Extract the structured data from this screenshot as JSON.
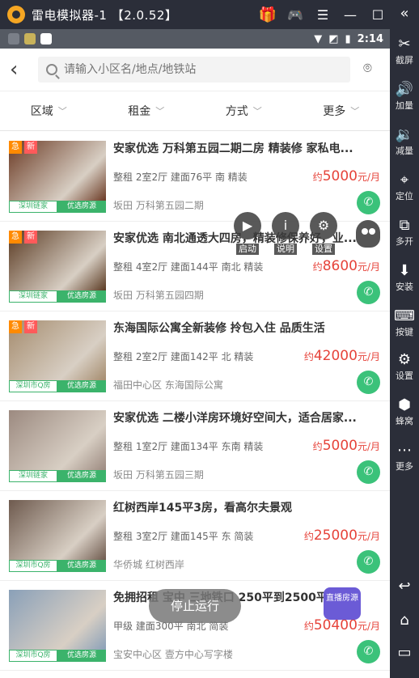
{
  "emulator": {
    "title": "雷电模拟器-1 【2.0.52】",
    "sidebar": [
      {
        "label": "截屏",
        "icon": "scissors-icon",
        "glyph": "✂"
      },
      {
        "label": "加量",
        "icon": "volume-up-icon",
        "glyph": "🔊"
      },
      {
        "label": "减量",
        "icon": "volume-down-icon",
        "glyph": "🔉"
      },
      {
        "label": "定位",
        "icon": "location-pin-icon",
        "glyph": "⌖"
      },
      {
        "label": "多开",
        "icon": "multi-window-icon",
        "glyph": "⧉"
      },
      {
        "label": "安装",
        "icon": "apk-install-icon",
        "glyph": "⬇"
      },
      {
        "label": "按键",
        "icon": "keyboard-icon",
        "glyph": "⌨"
      },
      {
        "label": "设置",
        "icon": "gear-icon",
        "glyph": "⚙"
      },
      {
        "label": "蜂窝",
        "icon": "honeycomb-icon",
        "glyph": "⬢"
      },
      {
        "label": "更多",
        "icon": "more-dots-icon",
        "glyph": "⋯"
      }
    ],
    "nav_buttons": [
      {
        "icon": "back-arrow-icon",
        "glyph": "↩"
      },
      {
        "icon": "home-icon",
        "glyph": "⌂"
      },
      {
        "icon": "recent-apps-icon",
        "glyph": "▭"
      }
    ]
  },
  "status_bar": {
    "time": "2:14"
  },
  "search": {
    "placeholder": "请输入小区名/地点/地铁站"
  },
  "filters": [
    "区域",
    "租金",
    "方式",
    "更多"
  ],
  "badges": {
    "urgent": "急",
    "new": "新"
  },
  "listings": [
    {
      "title": "安家优选 万科第五园二期二房 精装修 家私电...",
      "info": "整租 2室2厅 建面76平 南 精装",
      "price_prefix": "约",
      "price": "5000",
      "price_unit": "元/月",
      "address": "坂田 万科第五园二期",
      "source": "深圳链家",
      "tag": "优选房源",
      "urgent": true,
      "new": true,
      "img_color": "#6b3a24"
    },
    {
      "title": "安家优选 南北通透大四房，精装修保养好，业...",
      "info": "整租 4室2厅 建面144平 南北 精装",
      "price_prefix": "约",
      "price": "8600",
      "price_unit": "元/月",
      "address": "坂田 万科第五园四期",
      "source": "深圳链家",
      "tag": "优选房源",
      "urgent": true,
      "new": true,
      "img_color": "#5a3a22"
    },
    {
      "title": "东海国际公寓全新装修 拎包入住 品质生活",
      "info": "整租 2室2厅 建面142平 北 精装",
      "price_prefix": "约",
      "price": "42000",
      "price_unit": "元/月",
      "address": "福田中心区 东海国际公寓",
      "source": "深圳市Q房",
      "tag": "优选房源",
      "urgent": true,
      "new": true,
      "img_color": "#a58c6e"
    },
    {
      "title": "安家优选 二楼小洋房环境好空间大，适合居家...",
      "info": "整租 1室2厅 建面134平 东南 精装",
      "price_prefix": "约",
      "price": "5000",
      "price_unit": "元/月",
      "address": "坂田 万科第五园三期",
      "source": "深圳链家",
      "tag": "优选房源",
      "urgent": false,
      "new": false,
      "img_color": "#9c8a80"
    },
    {
      "title": "红树西岸145平3房，看高尔夫景观",
      "info": "整租 3室2厅 建面145平 东 简装",
      "price_prefix": "约",
      "price": "25000",
      "price_unit": "元/月",
      "address": "华侨城 红树西岸",
      "source": "深圳市Q房",
      "tag": "优选房源",
      "urgent": false,
      "new": false,
      "img_color": "#6e5a4e"
    },
    {
      "title": "免拥招租 宝中 三地铁口 250平到2500平",
      "info": "甲级 建面300平 南北 简装",
      "price_prefix": "约",
      "price": "50400",
      "price_unit": "元/月",
      "address": "宝安中心区 壹方中心写字楼",
      "source": "深圳市Q房",
      "tag": "优选房源",
      "urgent": false,
      "new": false,
      "img_color": "#8aa0b8"
    }
  ],
  "overlay": {
    "tools": [
      {
        "label": "启动",
        "icon": "play-icon",
        "glyph": "▶"
      },
      {
        "label": "说明",
        "icon": "info-icon",
        "glyph": "i"
      },
      {
        "label": "设置",
        "icon": "gear-icon",
        "glyph": "⚙"
      }
    ],
    "stop_label": "停止运行",
    "live_label": "直播房源"
  }
}
